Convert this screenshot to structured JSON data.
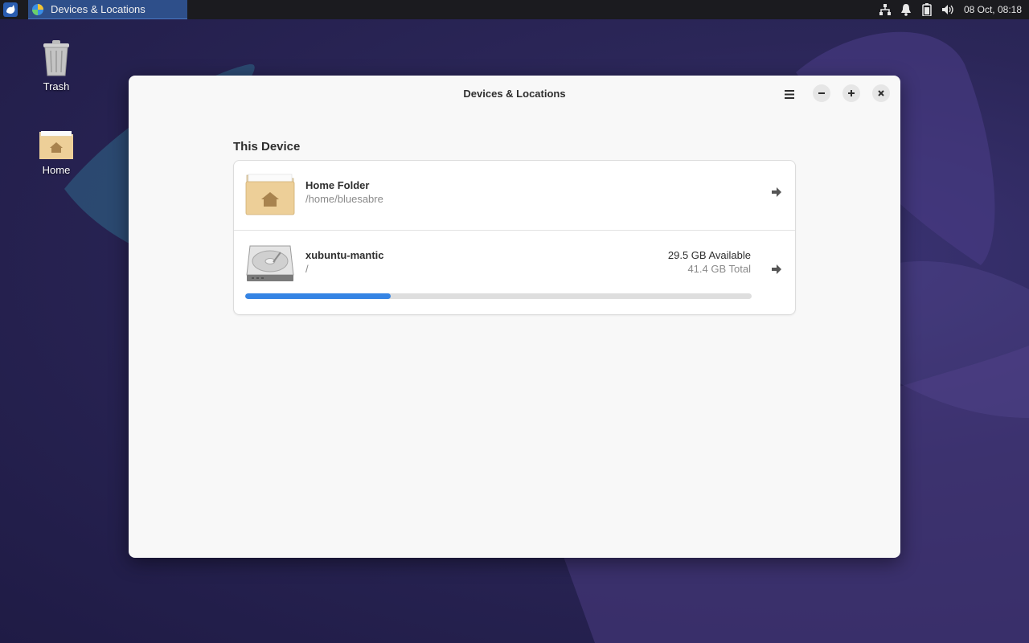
{
  "panel": {
    "task_title": "Devices & Locations",
    "clock": "08 Oct, 08:18",
    "tray_icons": [
      "network-icon",
      "notification-bell-icon",
      "battery-icon",
      "volume-icon"
    ]
  },
  "desktop": {
    "icons": [
      {
        "label": "Trash",
        "icon": "trash-icon"
      },
      {
        "label": "Home",
        "icon": "home-folder-icon"
      }
    ]
  },
  "window": {
    "title": "Devices & Locations",
    "buttons": {
      "menu": "hamburger-menu-icon",
      "minimize": "minimize-icon",
      "maximize": "maximize-icon",
      "close": "close-icon"
    },
    "section_title": "This Device",
    "locations": [
      {
        "name": "Home Folder",
        "path": "/home/bluesabre",
        "icon": "home-folder-icon"
      },
      {
        "name": "xubuntu-mantic",
        "path": "/",
        "icon": "hard-drive-icon",
        "available": "29.5 GB Available",
        "total": "41.4 GB Total",
        "used_fraction": 0.287
      }
    ]
  },
  "colors": {
    "accent": "#3584e4",
    "panel": "#1b1b1f",
    "window_bg": "#f8f8f8"
  }
}
